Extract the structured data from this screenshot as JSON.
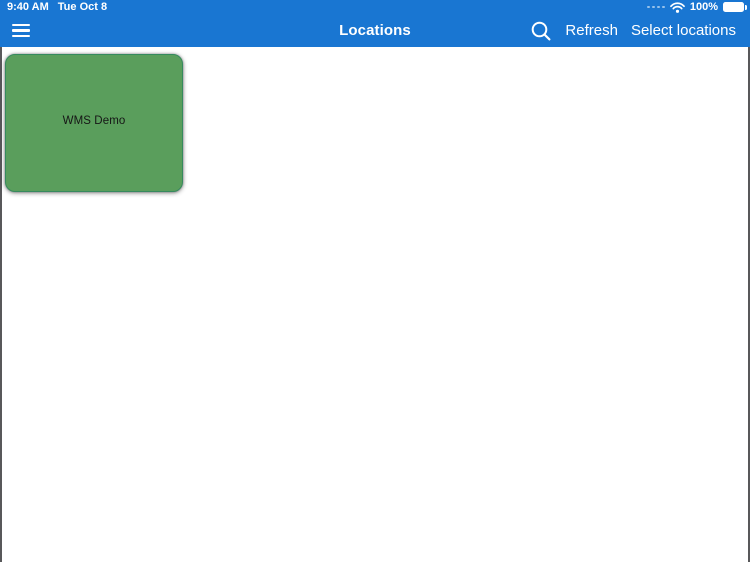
{
  "status_bar": {
    "time": "9:40 AM",
    "date": "Tue Oct 8",
    "battery_level": "100%",
    "icons": [
      "cellular-signal-dots",
      "wifi-icon",
      "battery-icon"
    ]
  },
  "nav_bar": {
    "title": "Locations",
    "menu_icon": "hamburger-icon",
    "search_icon": "search-icon",
    "refresh_label": "Refresh",
    "select_locations_label": "Select locations"
  },
  "main": {
    "location_tiles": [
      {
        "name": "WMS Demo"
      }
    ]
  },
  "colors": {
    "nav_blue": "#1976D2",
    "tile_green": "#5A9E5C",
    "tile_border": "#368A5E",
    "edge_line": "#58585A",
    "tile_text": "#161616"
  }
}
